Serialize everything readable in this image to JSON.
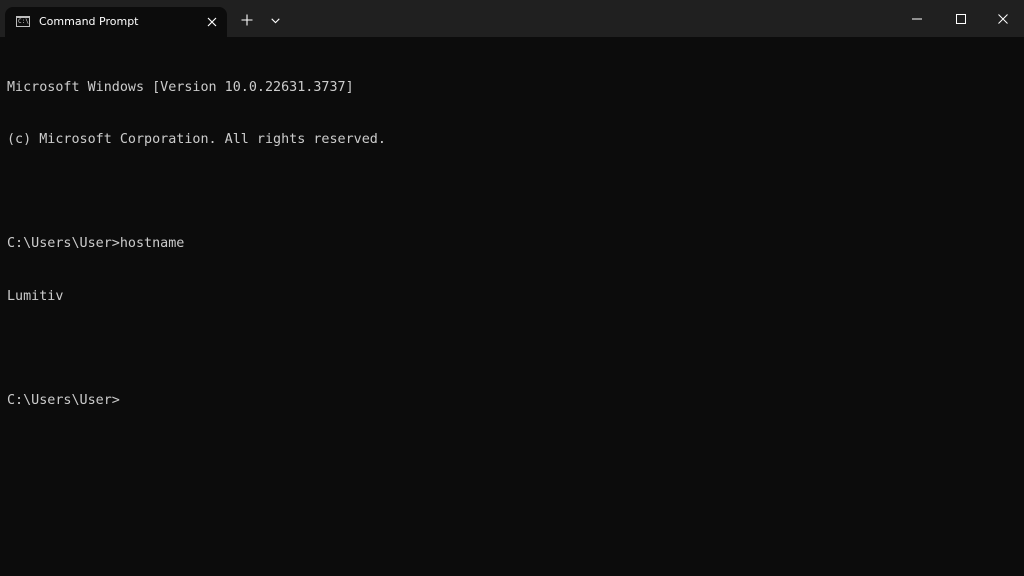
{
  "window": {
    "tab_title": "Command Prompt",
    "tab_icon_text": "C:\\_"
  },
  "icons": {
    "tab_icon": "command-prompt-icon",
    "tab_close": "close-icon",
    "new_tab": "plus-icon",
    "dropdown": "chevron-down-icon",
    "minimize": "minimize-icon",
    "maximize": "maximize-icon",
    "close": "close-icon"
  },
  "colors": {
    "background": "#0c0c0c",
    "titlebar": "#202020",
    "text": "#cccccc"
  },
  "console": {
    "lines": [
      "Microsoft Windows [Version 10.0.22631.3737]",
      "(c) Microsoft Corporation. All rights reserved.",
      "",
      "C:\\Users\\User>hostname",
      "Lumitiv",
      "",
      "C:\\Users\\User>"
    ]
  }
}
